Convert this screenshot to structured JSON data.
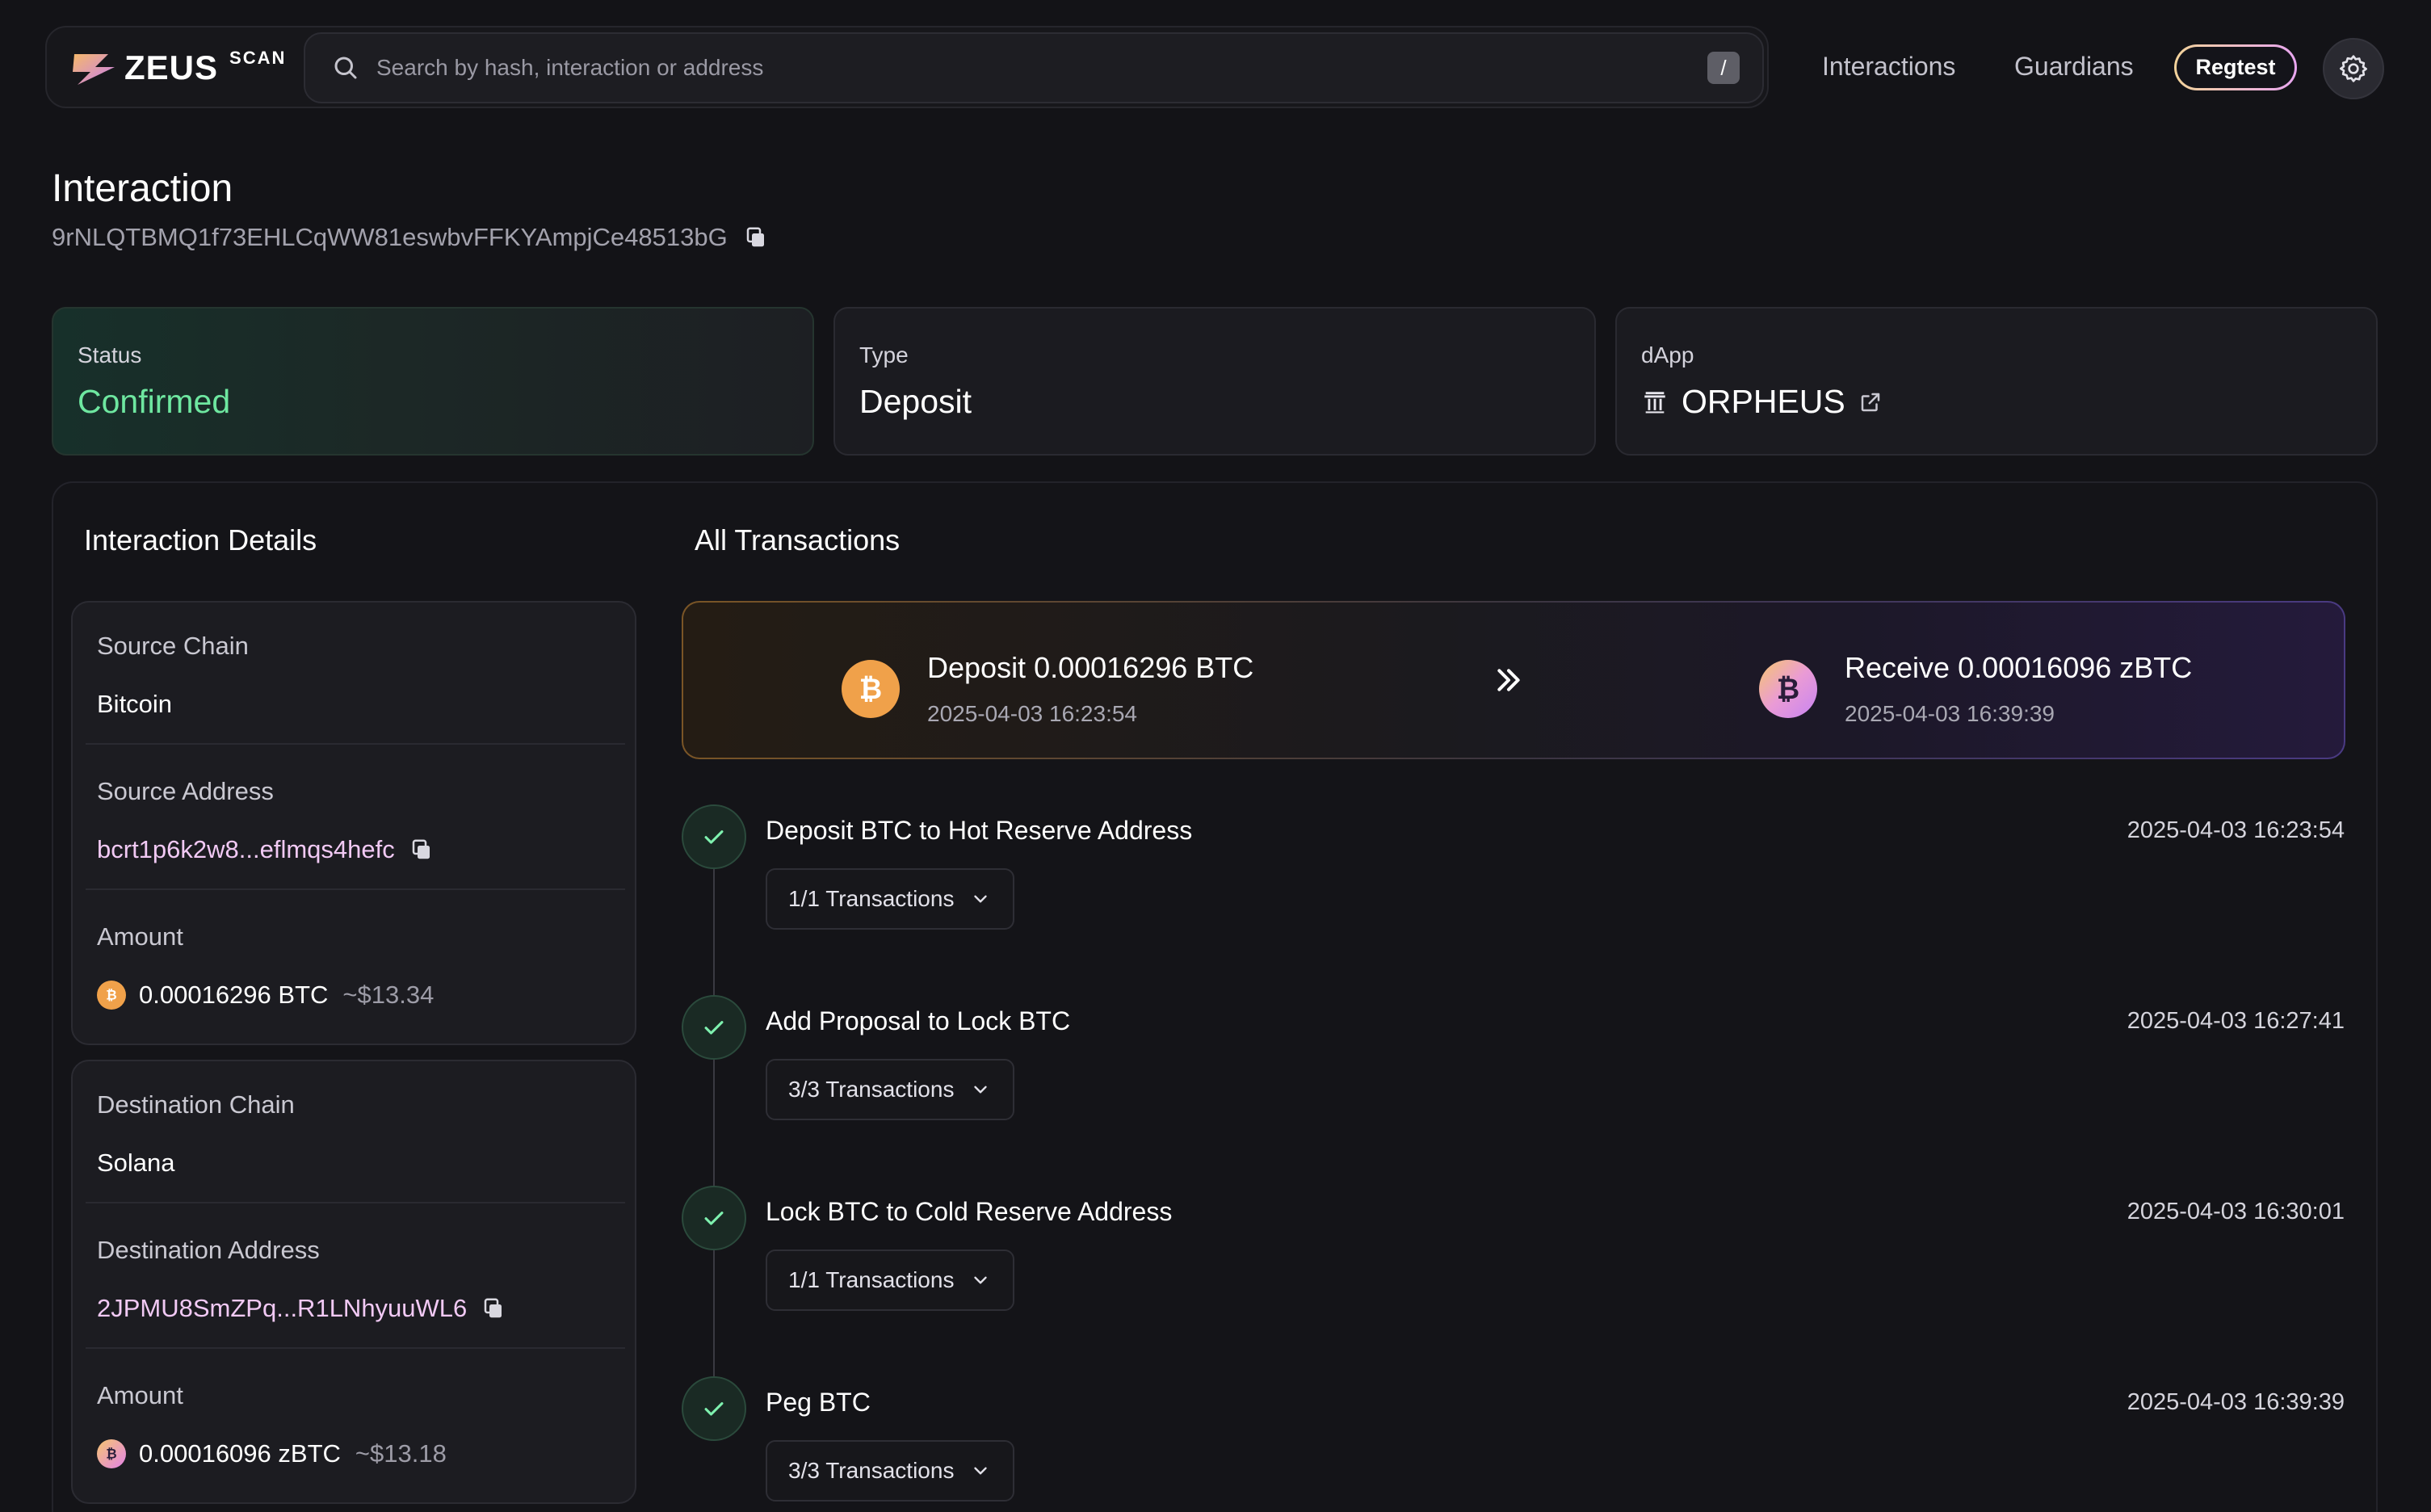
{
  "brand": {
    "name": "ZEUS",
    "sub": "SCAN"
  },
  "search": {
    "placeholder": "Search by hash, interaction or address",
    "shortcut": "/"
  },
  "nav": {
    "interactions": "Interactions",
    "guardians": "Guardians",
    "network": "Regtest"
  },
  "header": {
    "title": "Interaction",
    "hash": "9rNLQTBMQ1f73EHLCqWW81eswbvFFKYAmpjCe48513bG"
  },
  "cards": {
    "status": {
      "label": "Status",
      "value": "Confirmed"
    },
    "type": {
      "label": "Type",
      "value": "Deposit"
    },
    "dapp": {
      "label": "dApp",
      "value": "ORPHEUS"
    }
  },
  "details": {
    "title": "Interaction Details",
    "source": {
      "chain_label": "Source Chain",
      "chain": "Bitcoin",
      "address_label": "Source Address",
      "address": "bcrt1p6k2w8...eflmqs4hefc",
      "amount_label": "Amount",
      "amount": "0.00016296 BTC",
      "usd": "~$13.34"
    },
    "destination": {
      "chain_label": "Destination Chain",
      "chain": "Solana",
      "address_label": "Destination Address",
      "address": "2JPMU8SmZPq...R1LNhyuuWL6",
      "amount_label": "Amount",
      "amount": "0.00016096 zBTC",
      "usd": "~$13.18"
    }
  },
  "transactions": {
    "title": "All Transactions",
    "summary": {
      "deposit": {
        "title": "Deposit 0.00016296 BTC",
        "date": "2025-04-03 16:23:54"
      },
      "receive": {
        "title": "Receive 0.00016096 zBTC",
        "date": "2025-04-03 16:39:39"
      }
    },
    "steps": [
      {
        "title": "Deposit BTC to Hot Reserve Address",
        "time": "2025-04-03 16:23:54",
        "tx": "1/1 Transactions"
      },
      {
        "title": "Add Proposal to Lock BTC",
        "time": "2025-04-03 16:27:41",
        "tx": "3/3 Transactions"
      },
      {
        "title": "Lock BTC to Cold Reserve Address",
        "time": "2025-04-03 16:30:01",
        "tx": "1/1 Transactions"
      },
      {
        "title": "Peg BTC",
        "time": "2025-04-03 16:39:39",
        "tx": "3/3 Transactions"
      }
    ]
  },
  "colors": {
    "accent_green": "#6ee7a0",
    "btc_orange": "#f0a14a",
    "address_pink": "#f1c9f4"
  }
}
